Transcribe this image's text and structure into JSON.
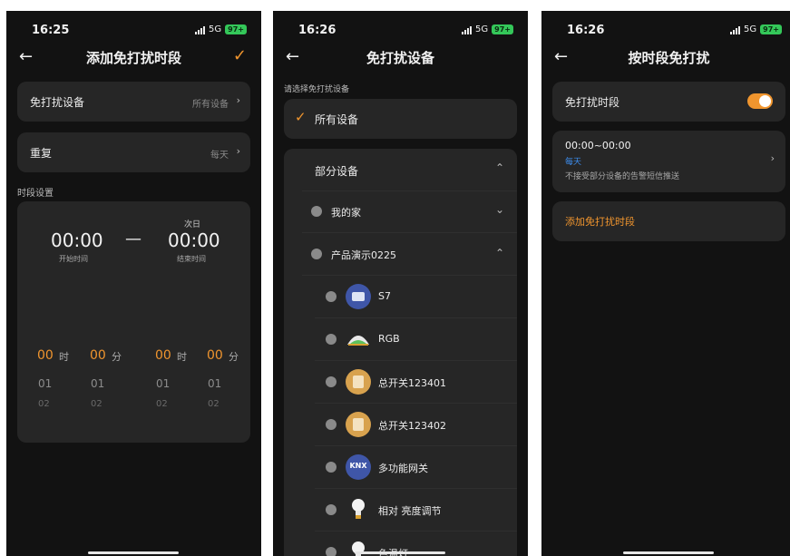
{
  "status": {
    "time_1": "16:25",
    "time_2": "16:26",
    "time_3": "16:26",
    "network": "5G",
    "battery": "97+"
  },
  "screen1": {
    "title": "添加免打扰时段",
    "dnd_device_label": "免打扰设备",
    "dnd_device_value": "所有设备",
    "repeat_label": "重复",
    "repeat_value": "每天",
    "section_label": "时段设置",
    "next_day": "次日",
    "start_time": "00:00",
    "dash": "—",
    "end_time": "00:00",
    "start_caption": "开始时间",
    "end_caption": "结束时间",
    "picker": {
      "selected": [
        "00",
        "00",
        "00",
        "00"
      ],
      "units": [
        "时",
        "分",
        "时",
        "分"
      ],
      "row1": [
        "01",
        "01",
        "01",
        "01"
      ],
      "row2": [
        "02",
        "02",
        "02",
        "02"
      ]
    }
  },
  "screen2": {
    "title": "免打扰设备",
    "hint": "请选择免打扰设备",
    "all_devices": "所有设备",
    "partial_devices": "部分设备",
    "groups": [
      {
        "label": "我的家"
      },
      {
        "label": "产品演示0225"
      }
    ],
    "devices": [
      {
        "label": "S7",
        "icon": "panel-icon"
      },
      {
        "label": "RGB",
        "icon": "rgb-lamp-icon"
      },
      {
        "label": "总开关123401",
        "icon": "switch-icon"
      },
      {
        "label": "总开关123402",
        "icon": "switch-icon"
      },
      {
        "label": "多功能网关",
        "icon": "knx-gateway-icon"
      },
      {
        "label": "相对 亮度调节",
        "icon": "bulb-icon"
      },
      {
        "label": "色温灯",
        "icon": "bulb-icon"
      }
    ]
  },
  "screen3": {
    "title": "按时段免打扰",
    "toggle_label": "免打扰时段",
    "period_time": "00:00~00:00",
    "period_repeat": "每天",
    "period_desc": "不接受部分设备的告警短信推送",
    "add_period": "添加免打扰时段"
  },
  "colors": {
    "accent": "#f0952e",
    "link_blue": "#3d8ef0",
    "background": "#121212",
    "card": "#262626"
  }
}
